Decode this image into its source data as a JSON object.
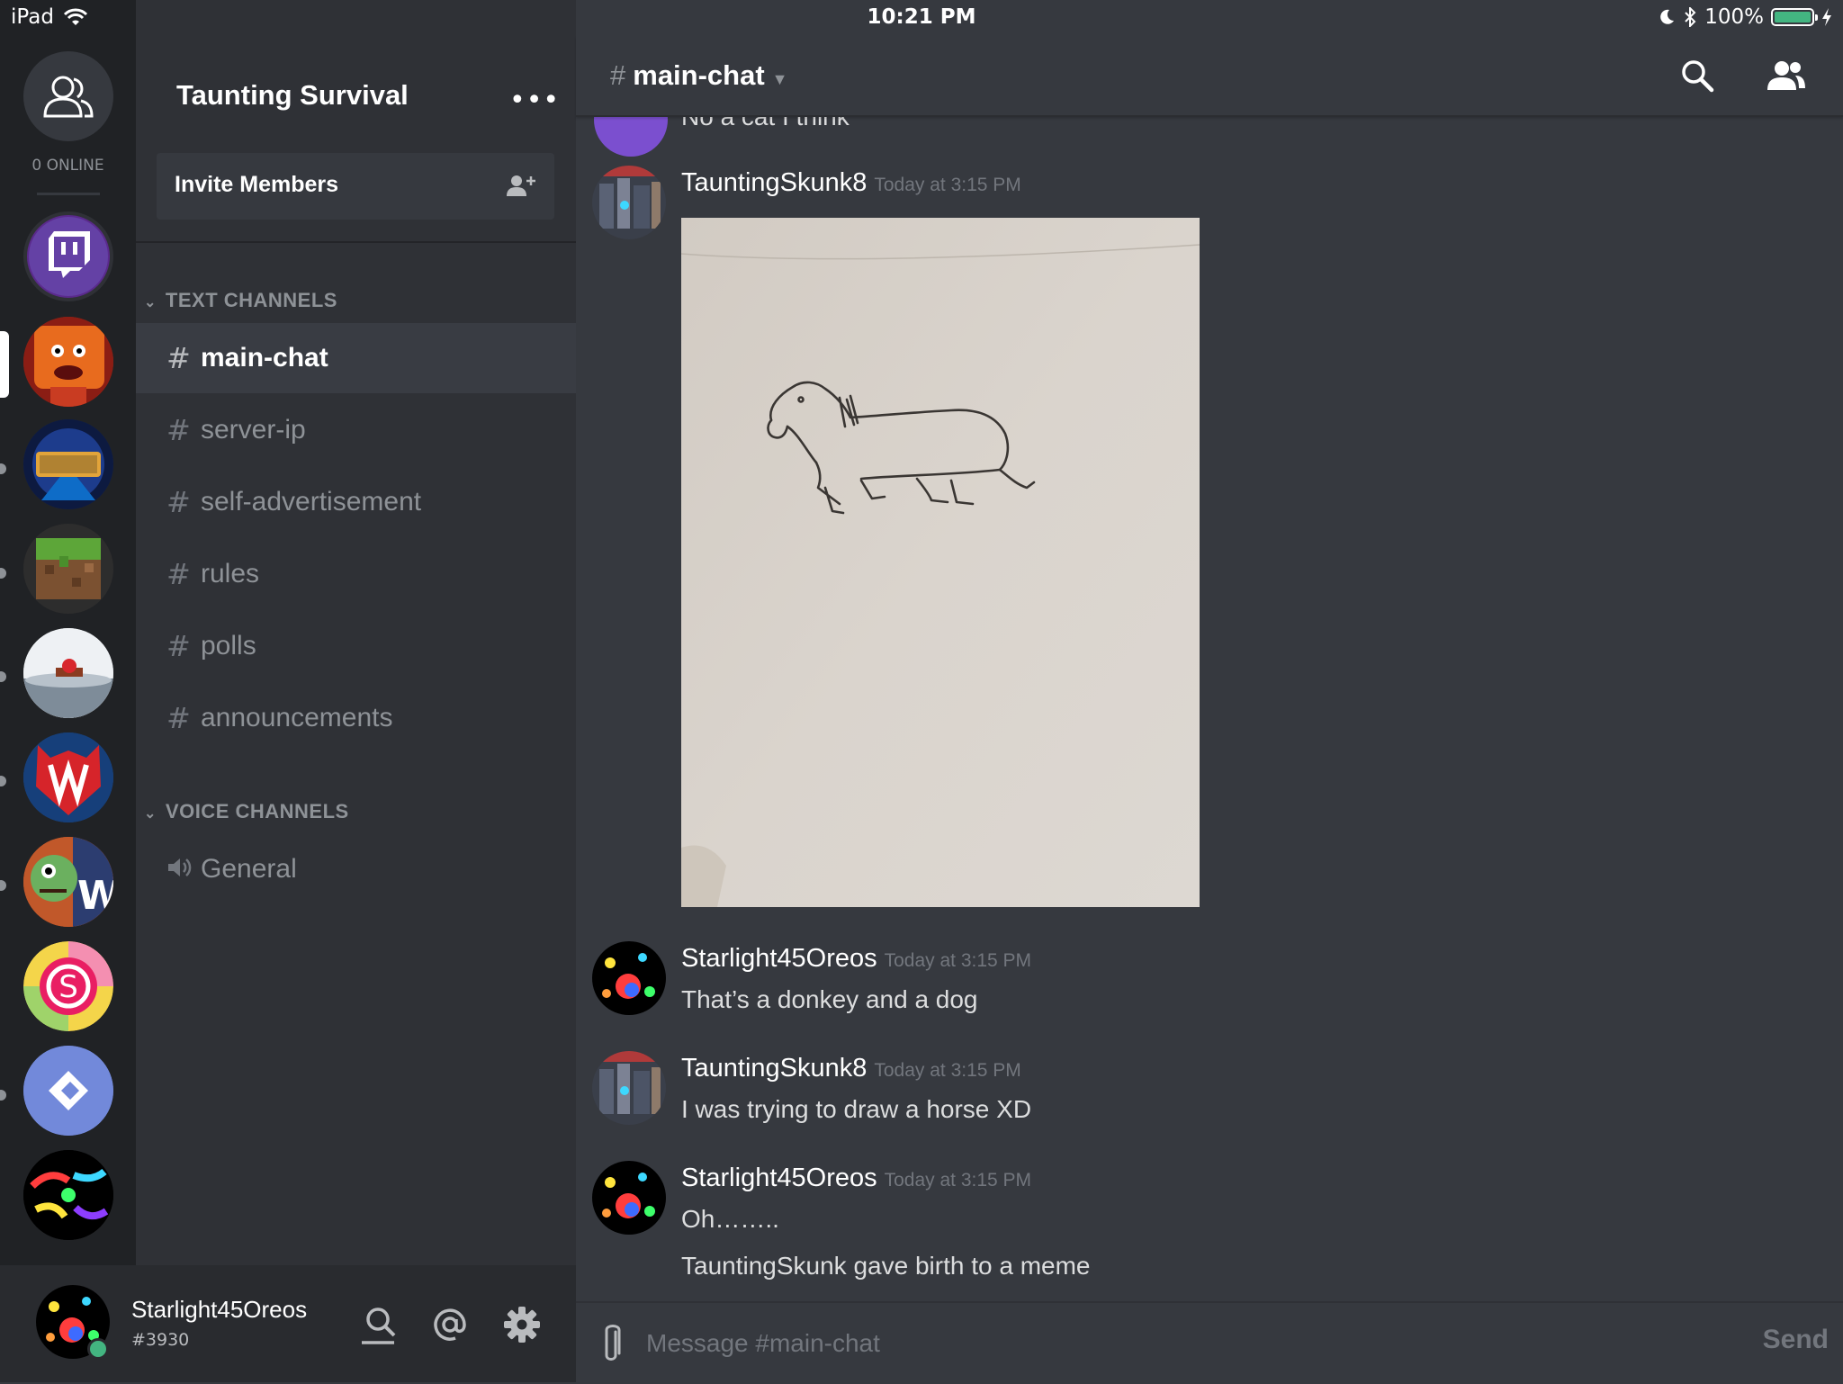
{
  "status_bar": {
    "device": "iPad",
    "time": "10:21 PM",
    "battery": "100%",
    "battery_level": 1.0,
    "icons": [
      "wifi-icon",
      "moon-icon",
      "bluetooth-icon",
      "battery-icon",
      "charging-icon"
    ]
  },
  "guild_rail": {
    "online_label": "0 ONLINE",
    "guilds": [
      {
        "name": "guild-twitch",
        "icon": "twitch-icon",
        "selected": false
      },
      {
        "name": "guild-taunting-survival",
        "icon": "orange-character-icon",
        "selected": true
      },
      {
        "name": "guild-official-server",
        "icon": "official-server-icon",
        "selected": false
      },
      {
        "name": "guild-minecraft",
        "icon": "grass-block-icon",
        "selected": false
      },
      {
        "name": "guild-clouds",
        "icon": "clouds-icon",
        "selected": false
      },
      {
        "name": "guild-av",
        "icon": "av-logo-icon",
        "selected": false
      },
      {
        "name": "guild-w",
        "icon": "zombie-w-icon",
        "selected": false
      },
      {
        "name": "guild-s",
        "icon": "s-logo-icon",
        "selected": false
      },
      {
        "name": "guild-arrow",
        "icon": "arrow-logo-icon",
        "selected": false
      },
      {
        "name": "guild-rainbow",
        "icon": "rainbow-icon",
        "selected": false
      }
    ]
  },
  "server": {
    "name": "Taunting Survival",
    "menu_label": "•••",
    "invite_label": "Invite Members"
  },
  "channels": {
    "text_category": "TEXT CHANNELS",
    "text": [
      {
        "name": "main-chat",
        "active": true
      },
      {
        "name": "server-ip",
        "active": false
      },
      {
        "name": "self-advertisement",
        "active": false
      },
      {
        "name": "rules",
        "active": false
      },
      {
        "name": "polls",
        "active": false
      },
      {
        "name": "announcements",
        "active": false
      }
    ],
    "voice_category": "VOICE CHANNELS",
    "voice": [
      {
        "name": "General"
      }
    ]
  },
  "user": {
    "name": "Starlight45Oreos",
    "tag": "#3930",
    "status": "online"
  },
  "chat": {
    "channel": "main-chat",
    "hash": "#",
    "messages": {
      "partial_text": "No a cat I think",
      "m1": {
        "author": "TauntingSkunk8",
        "timestamp": "Today at 3:15 PM"
      },
      "m2": {
        "author": "Starlight45Oreos",
        "timestamp": "Today at 3:15 PM",
        "text": "That’s a donkey and a dog"
      },
      "m3": {
        "author": "TauntingSkunk8",
        "timestamp": "Today at 3:15 PM",
        "text": "I was trying to draw a horse XD"
      },
      "m4": {
        "author": "Starlight45Oreos",
        "timestamp": "Today at 3:15 PM",
        "text": "Oh……..",
        "text2": "TauntingSkunk gave birth to a meme"
      }
    }
  },
  "composer": {
    "placeholder": "Message #main-chat",
    "send_label": "Send"
  },
  "colors": {
    "accent": "#7289da",
    "online": "#43b581",
    "background": "#36393f",
    "sidebar": "#2f3136",
    "rail": "#202225"
  }
}
